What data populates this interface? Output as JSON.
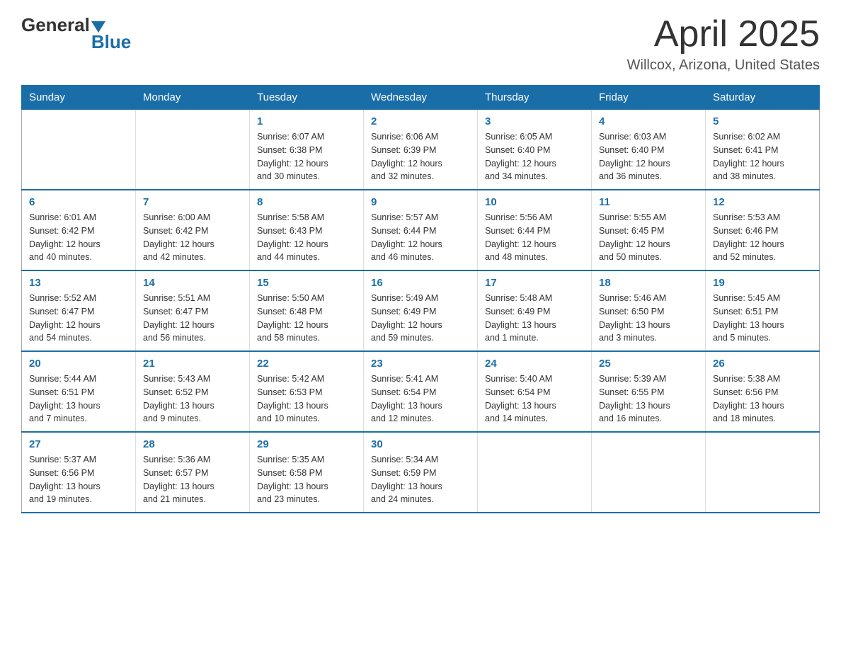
{
  "logo": {
    "general": "General",
    "blue": "Blue"
  },
  "header": {
    "month": "April 2025",
    "location": "Willcox, Arizona, United States"
  },
  "days_of_week": [
    "Sunday",
    "Monday",
    "Tuesday",
    "Wednesday",
    "Thursday",
    "Friday",
    "Saturday"
  ],
  "weeks": [
    [
      {
        "day": "",
        "info": ""
      },
      {
        "day": "",
        "info": ""
      },
      {
        "day": "1",
        "info": "Sunrise: 6:07 AM\nSunset: 6:38 PM\nDaylight: 12 hours\nand 30 minutes."
      },
      {
        "day": "2",
        "info": "Sunrise: 6:06 AM\nSunset: 6:39 PM\nDaylight: 12 hours\nand 32 minutes."
      },
      {
        "day": "3",
        "info": "Sunrise: 6:05 AM\nSunset: 6:40 PM\nDaylight: 12 hours\nand 34 minutes."
      },
      {
        "day": "4",
        "info": "Sunrise: 6:03 AM\nSunset: 6:40 PM\nDaylight: 12 hours\nand 36 minutes."
      },
      {
        "day": "5",
        "info": "Sunrise: 6:02 AM\nSunset: 6:41 PM\nDaylight: 12 hours\nand 38 minutes."
      }
    ],
    [
      {
        "day": "6",
        "info": "Sunrise: 6:01 AM\nSunset: 6:42 PM\nDaylight: 12 hours\nand 40 minutes."
      },
      {
        "day": "7",
        "info": "Sunrise: 6:00 AM\nSunset: 6:42 PM\nDaylight: 12 hours\nand 42 minutes."
      },
      {
        "day": "8",
        "info": "Sunrise: 5:58 AM\nSunset: 6:43 PM\nDaylight: 12 hours\nand 44 minutes."
      },
      {
        "day": "9",
        "info": "Sunrise: 5:57 AM\nSunset: 6:44 PM\nDaylight: 12 hours\nand 46 minutes."
      },
      {
        "day": "10",
        "info": "Sunrise: 5:56 AM\nSunset: 6:44 PM\nDaylight: 12 hours\nand 48 minutes."
      },
      {
        "day": "11",
        "info": "Sunrise: 5:55 AM\nSunset: 6:45 PM\nDaylight: 12 hours\nand 50 minutes."
      },
      {
        "day": "12",
        "info": "Sunrise: 5:53 AM\nSunset: 6:46 PM\nDaylight: 12 hours\nand 52 minutes."
      }
    ],
    [
      {
        "day": "13",
        "info": "Sunrise: 5:52 AM\nSunset: 6:47 PM\nDaylight: 12 hours\nand 54 minutes."
      },
      {
        "day": "14",
        "info": "Sunrise: 5:51 AM\nSunset: 6:47 PM\nDaylight: 12 hours\nand 56 minutes."
      },
      {
        "day": "15",
        "info": "Sunrise: 5:50 AM\nSunset: 6:48 PM\nDaylight: 12 hours\nand 58 minutes."
      },
      {
        "day": "16",
        "info": "Sunrise: 5:49 AM\nSunset: 6:49 PM\nDaylight: 12 hours\nand 59 minutes."
      },
      {
        "day": "17",
        "info": "Sunrise: 5:48 AM\nSunset: 6:49 PM\nDaylight: 13 hours\nand 1 minute."
      },
      {
        "day": "18",
        "info": "Sunrise: 5:46 AM\nSunset: 6:50 PM\nDaylight: 13 hours\nand 3 minutes."
      },
      {
        "day": "19",
        "info": "Sunrise: 5:45 AM\nSunset: 6:51 PM\nDaylight: 13 hours\nand 5 minutes."
      }
    ],
    [
      {
        "day": "20",
        "info": "Sunrise: 5:44 AM\nSunset: 6:51 PM\nDaylight: 13 hours\nand 7 minutes."
      },
      {
        "day": "21",
        "info": "Sunrise: 5:43 AM\nSunset: 6:52 PM\nDaylight: 13 hours\nand 9 minutes."
      },
      {
        "day": "22",
        "info": "Sunrise: 5:42 AM\nSunset: 6:53 PM\nDaylight: 13 hours\nand 10 minutes."
      },
      {
        "day": "23",
        "info": "Sunrise: 5:41 AM\nSunset: 6:54 PM\nDaylight: 13 hours\nand 12 minutes."
      },
      {
        "day": "24",
        "info": "Sunrise: 5:40 AM\nSunset: 6:54 PM\nDaylight: 13 hours\nand 14 minutes."
      },
      {
        "day": "25",
        "info": "Sunrise: 5:39 AM\nSunset: 6:55 PM\nDaylight: 13 hours\nand 16 minutes."
      },
      {
        "day": "26",
        "info": "Sunrise: 5:38 AM\nSunset: 6:56 PM\nDaylight: 13 hours\nand 18 minutes."
      }
    ],
    [
      {
        "day": "27",
        "info": "Sunrise: 5:37 AM\nSunset: 6:56 PM\nDaylight: 13 hours\nand 19 minutes."
      },
      {
        "day": "28",
        "info": "Sunrise: 5:36 AM\nSunset: 6:57 PM\nDaylight: 13 hours\nand 21 minutes."
      },
      {
        "day": "29",
        "info": "Sunrise: 5:35 AM\nSunset: 6:58 PM\nDaylight: 13 hours\nand 23 minutes."
      },
      {
        "day": "30",
        "info": "Sunrise: 5:34 AM\nSunset: 6:59 PM\nDaylight: 13 hours\nand 24 minutes."
      },
      {
        "day": "",
        "info": ""
      },
      {
        "day": "",
        "info": ""
      },
      {
        "day": "",
        "info": ""
      }
    ]
  ]
}
